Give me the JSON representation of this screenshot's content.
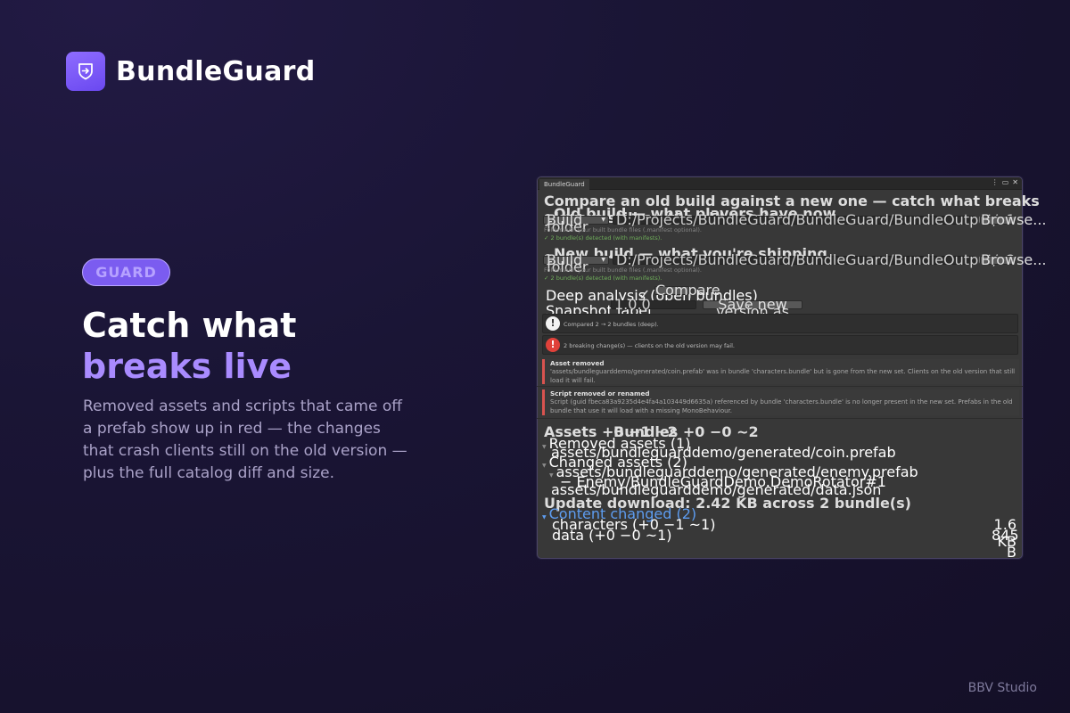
{
  "brand": {
    "name": "BundleGuard",
    "logo_icon": "shield-arrow-icon"
  },
  "hero": {
    "pill": "GUARD",
    "headline_line1": "Catch what",
    "headline_line2": "breaks live",
    "description": "Removed assets and scripts that came off a prefab show up in red — the changes that crash clients still on the old version — plus the full catalog diff and size."
  },
  "footer": {
    "studio": "BBV Studio"
  },
  "colors": {
    "accent": "#7b5cf0",
    "accent_light": "#a98bff",
    "error": "#d9534f",
    "success": "#6fae5a",
    "link": "#5d9cf0"
  },
  "editor": {
    "tab": "BundleGuard",
    "intro": "Compare an old build against a new one — catch what breaks players still on the old version.",
    "old_build": {
      "index": "1",
      "title": "Old build — what players have now",
      "source": "Build folder",
      "path": "D:/Projects/BundleGuard/BundleGuard/BundleOutput/v1",
      "browse": "Browse...",
      "hint": "Folder with your built bundle files (.manifest optional).",
      "status": "✓ 2 bundle(s) detected (with manifests)."
    },
    "new_build": {
      "index": "2",
      "title": "New build — what you're shipping",
      "source": "Build folder",
      "path": "D:/Projects/BundleGuard/BundleGuard/BundleOutput/v2",
      "browse": "Browse...",
      "hint": "Folder with your built bundle files (.manifest optional).",
      "status": "✓ 2 bundle(s) detected (with manifests)."
    },
    "deep_analysis_label": "Deep analysis (open bundles)",
    "deep_analysis_checked": "✓",
    "compare_button": "Compare",
    "snapshot_label": "Snapshot label",
    "snapshot_value": "1.0.0",
    "snapshot_button": "Save new version as snapshot",
    "info_message": "Compared 2 → 2 bundles (deep).",
    "error_message": "2 breaking change(s) — clients on the old version may fail.",
    "issues": [
      {
        "title": "Asset removed",
        "body": "'assets/bundleguarddemo/generated/coin.prefab' was in bundle 'characters.bundle' but is gone from the new set. Clients on the old version that still load it will fail."
      },
      {
        "title": "Script removed or renamed",
        "body": "Script (guid fbeca83a9235d4e4fa4a103449d6635a) referenced by bundle 'characters.bundle' is no longer present in the new set. Prefabs in the old bundle that use it will load with a missing MonoBehaviour."
      }
    ],
    "summary": {
      "assets": "Assets  +0  −1  ~2",
      "bundles": "Bundles  +0  −0  ~2",
      "removed_header": "Removed assets (1)",
      "removed_items": [
        "assets/bundleguarddemo/generated/coin.prefab"
      ],
      "changed_header": "Changed assets (2)",
      "changed_item_1": "assets/bundleguarddemo/generated/enemy.prefab",
      "changed_item_1_detail": "− Enemy/BundleGuardDemo.DemoRotator#1",
      "changed_item_2": "assets/bundleguarddemo/generated/data.json",
      "update_download": "Update download: 2.42 KB across 2 bundle(s)",
      "content_changed_header": "Content changed (2)",
      "bundles_list": [
        {
          "name": "characters  (+0 −1 ~1)",
          "size": "1.6 KB"
        },
        {
          "name": "data  (+0 −0 ~1)",
          "size": "845 B"
        }
      ]
    }
  }
}
